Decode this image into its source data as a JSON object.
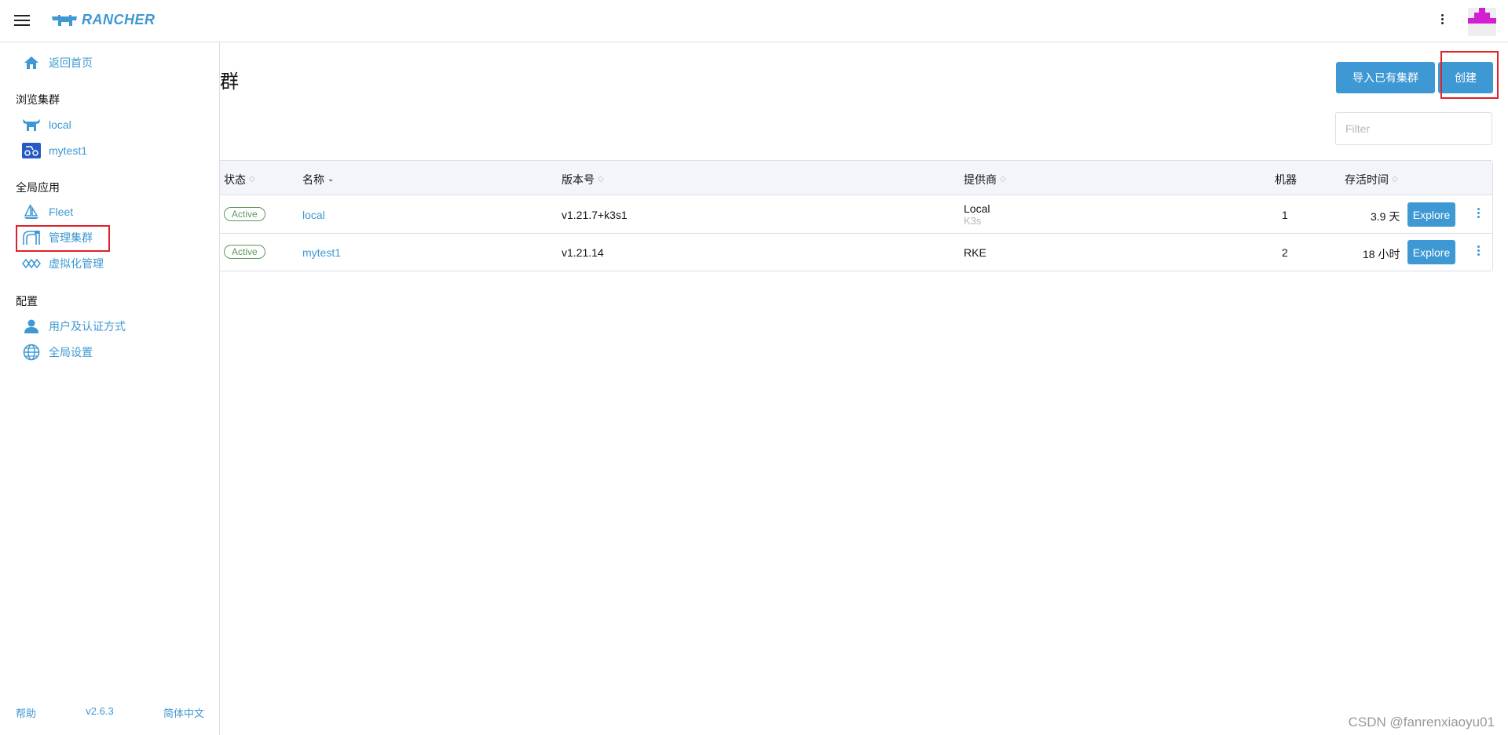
{
  "header": {
    "brand": "RANCHER",
    "colors": {
      "accent": "#3d98d3",
      "avatar": "#d41ed4"
    }
  },
  "sidebar": {
    "home": "返回首页",
    "groups": {
      "browse": "浏览集群",
      "global_apps": "全局应用",
      "config": "配置"
    },
    "clusters": [
      {
        "label": "local",
        "icon": "cow-icon"
      },
      {
        "label": "mytest1",
        "icon": "cluster-icon"
      }
    ],
    "apps": [
      {
        "label": "Fleet",
        "icon": "sailboat-icon"
      },
      {
        "label": "管理集群",
        "icon": "cluster-manager-icon"
      },
      {
        "label": "虚拟化管理",
        "icon": "virtualization-icon"
      }
    ],
    "settings": [
      {
        "label": "用户及认证方式",
        "icon": "user-icon"
      },
      {
        "label": "全局设置",
        "icon": "globe-icon"
      }
    ],
    "footer": {
      "help": "帮助",
      "version": "v2.6.3",
      "language": "简体中文"
    }
  },
  "main": {
    "title": "群",
    "import_button": "导入已有集群",
    "create_button": "创建",
    "filter_placeholder": "Filter",
    "columns": {
      "state": "状态",
      "name": "名称",
      "version": "版本号",
      "provider": "提供商",
      "machines": "机器",
      "age": "存活时间"
    },
    "rows": [
      {
        "state": "Active",
        "name": "local",
        "version": "v1.21.7+k3s1",
        "provider": "Local",
        "provider_sub": "K3s",
        "machines": "1",
        "age": "3.9 天",
        "action": "Explore"
      },
      {
        "state": "Active",
        "name": "mytest1",
        "version": "v1.21.14",
        "provider": "RKE",
        "provider_sub": "",
        "machines": "2",
        "age": "18 小时",
        "action": "Explore"
      }
    ]
  },
  "watermark": "CSDN @fanrenxiaoyu01"
}
